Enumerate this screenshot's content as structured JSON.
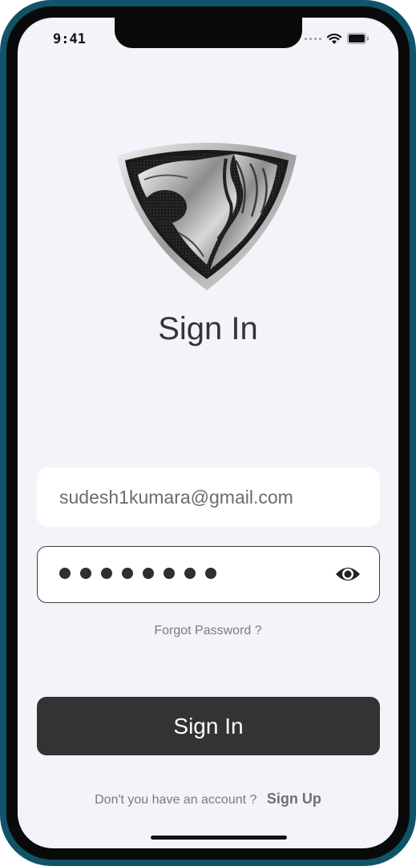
{
  "status_bar": {
    "time": "9:41"
  },
  "screen": {
    "title": "Sign In"
  },
  "form": {
    "email_value": "sudesh1kumara@gmail.com",
    "password_dot_count": 8,
    "forgot_label": "Forgot Password ?",
    "submit_label": "Sign In"
  },
  "footer": {
    "prompt": "Don't you have an account ?",
    "signup_label": "Sign Up"
  },
  "colors": {
    "frame": "#0f5469",
    "background": "#f3f4f9",
    "button": "#333333",
    "title_text": "#333438"
  },
  "icons": [
    "wifi-icon",
    "battery-icon",
    "shield-logo-icon",
    "eye-icon"
  ]
}
